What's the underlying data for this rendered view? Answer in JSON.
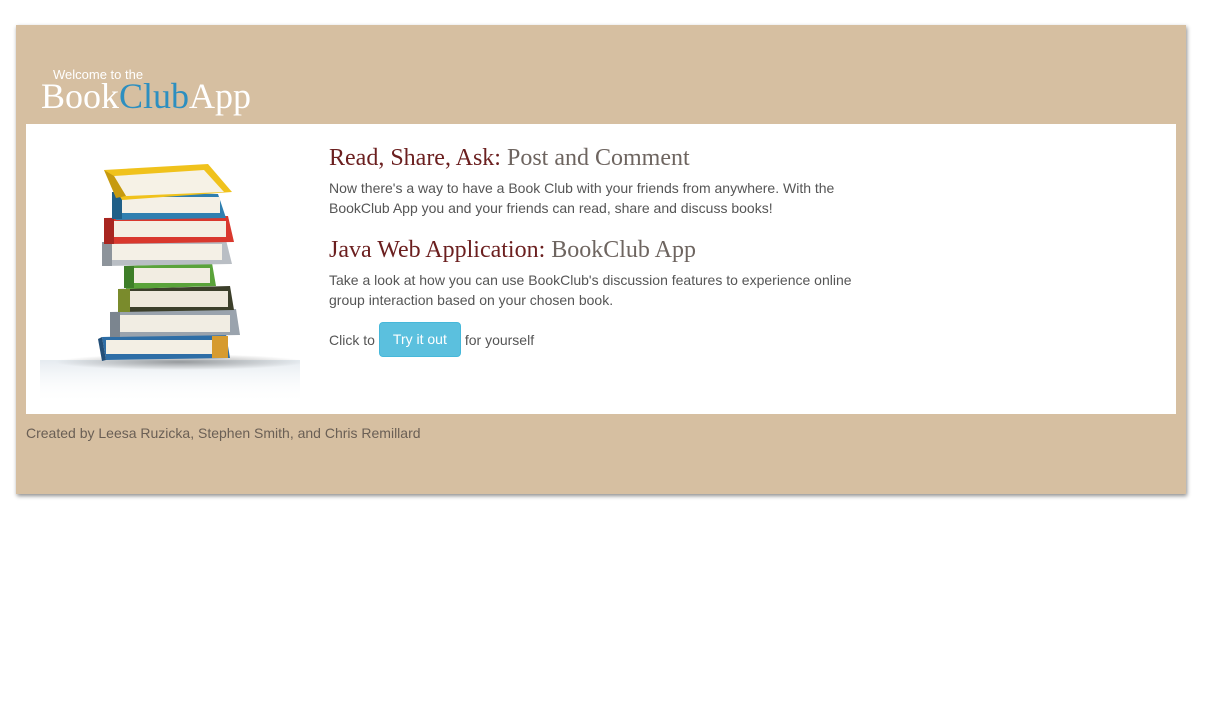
{
  "header": {
    "welcome": "Welcome to the",
    "logo_part1": "Book",
    "logo_part2": "Club",
    "logo_part3": "App"
  },
  "sections": [
    {
      "title_lead": "Read, Share, Ask:",
      "title_rest": "Post and Comment",
      "body": "Now there's a way to have a Book Club with your friends from anywhere. With the BookClub App you and your friends can read, share and discuss books!"
    },
    {
      "title_lead": "Java Web Application:",
      "title_rest": "BookClub App",
      "body": "Take a look at how you can use BookClub's discussion features to experience online group interaction based on your chosen book."
    }
  ],
  "cta": {
    "before": "Click to",
    "button": "Try it out",
    "after": "for yourself"
  },
  "footer": {
    "credits": "Created by Leesa Ruzicka, Stephen Smith, and Chris Remillard"
  },
  "colors": {
    "frame": "#d6bfa1",
    "logo_accent": "#2d8fc0",
    "heading_lead": "#6b1f1f",
    "button": "#5bc0de"
  },
  "image": {
    "icon": "stacked-books-illustration"
  }
}
